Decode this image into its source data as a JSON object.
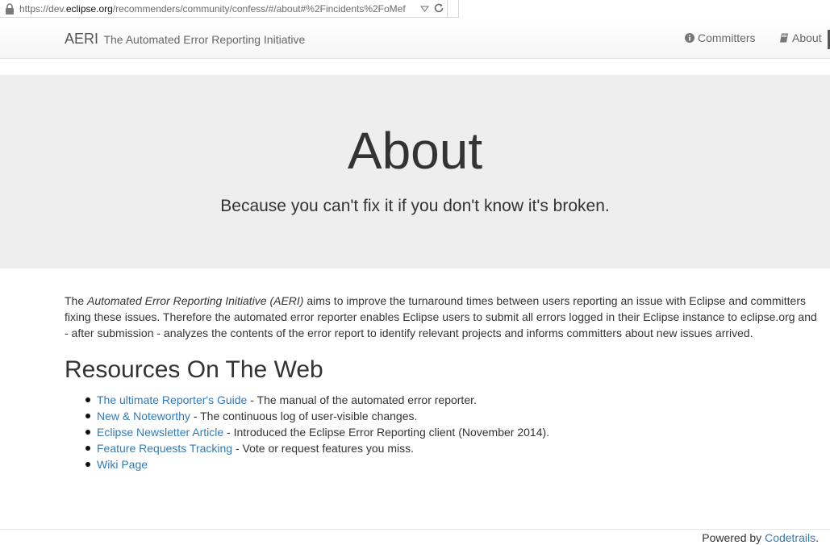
{
  "browser": {
    "url_prefix": "https://dev.",
    "url_host": "eclipse.org",
    "url_path": "/recommenders/community/confess/#/about#%2Fincidents%2FoMef"
  },
  "navbar": {
    "brand_short": "AERI",
    "brand_long": "The Automated Error Reporting Initiative",
    "committers_label": "Committers",
    "about_label": "About"
  },
  "jumbotron": {
    "title": "About",
    "tagline": "Because you can't fix it if you don't know it's broken."
  },
  "intro": {
    "lead": "The ",
    "emph": "Automated Error Reporting Initiative (AERI)",
    "rest": " aims to improve the turnaround times between users reporting an issue with Eclipse and committers fixing these issues. Therefore the automated error reporter enables Eclipse users to submit all errors logged in their Eclipse instance to eclipse.org and - after submission - analyzes the contents of the error report to identify relevant projects and informs committers about new issues arrived."
  },
  "resources": {
    "title": "Resources On The Web",
    "items": [
      {
        "link": "The ultimate Reporter's Guide",
        "desc": " - The manual of the automated error reporter."
      },
      {
        "link": "New & Noteworthy",
        "desc": " - The continuous log of user-visible changes."
      },
      {
        "link": "Eclipse Newsletter Article",
        "desc": " - Introduced the Eclipse Error Reporting client (November 2014)."
      },
      {
        "link": "Feature Requests Tracking",
        "desc": " - Vote or request features you miss."
      },
      {
        "link": "Wiki Page",
        "desc": ""
      }
    ]
  },
  "footer": {
    "powered_by": "Powered by ",
    "powered_link": "Codetrails",
    "period": "."
  },
  "colors": {
    "link": "#337ab7",
    "jumbotron_bg": "#eeeeee",
    "text": "#333333"
  },
  "icons": {
    "address_lock": "lock-icon",
    "address_dropdown": "dropdown-arrow-icon",
    "address_reload": "reload-icon",
    "committers": "info-circle-icon",
    "about": "book-icon"
  }
}
